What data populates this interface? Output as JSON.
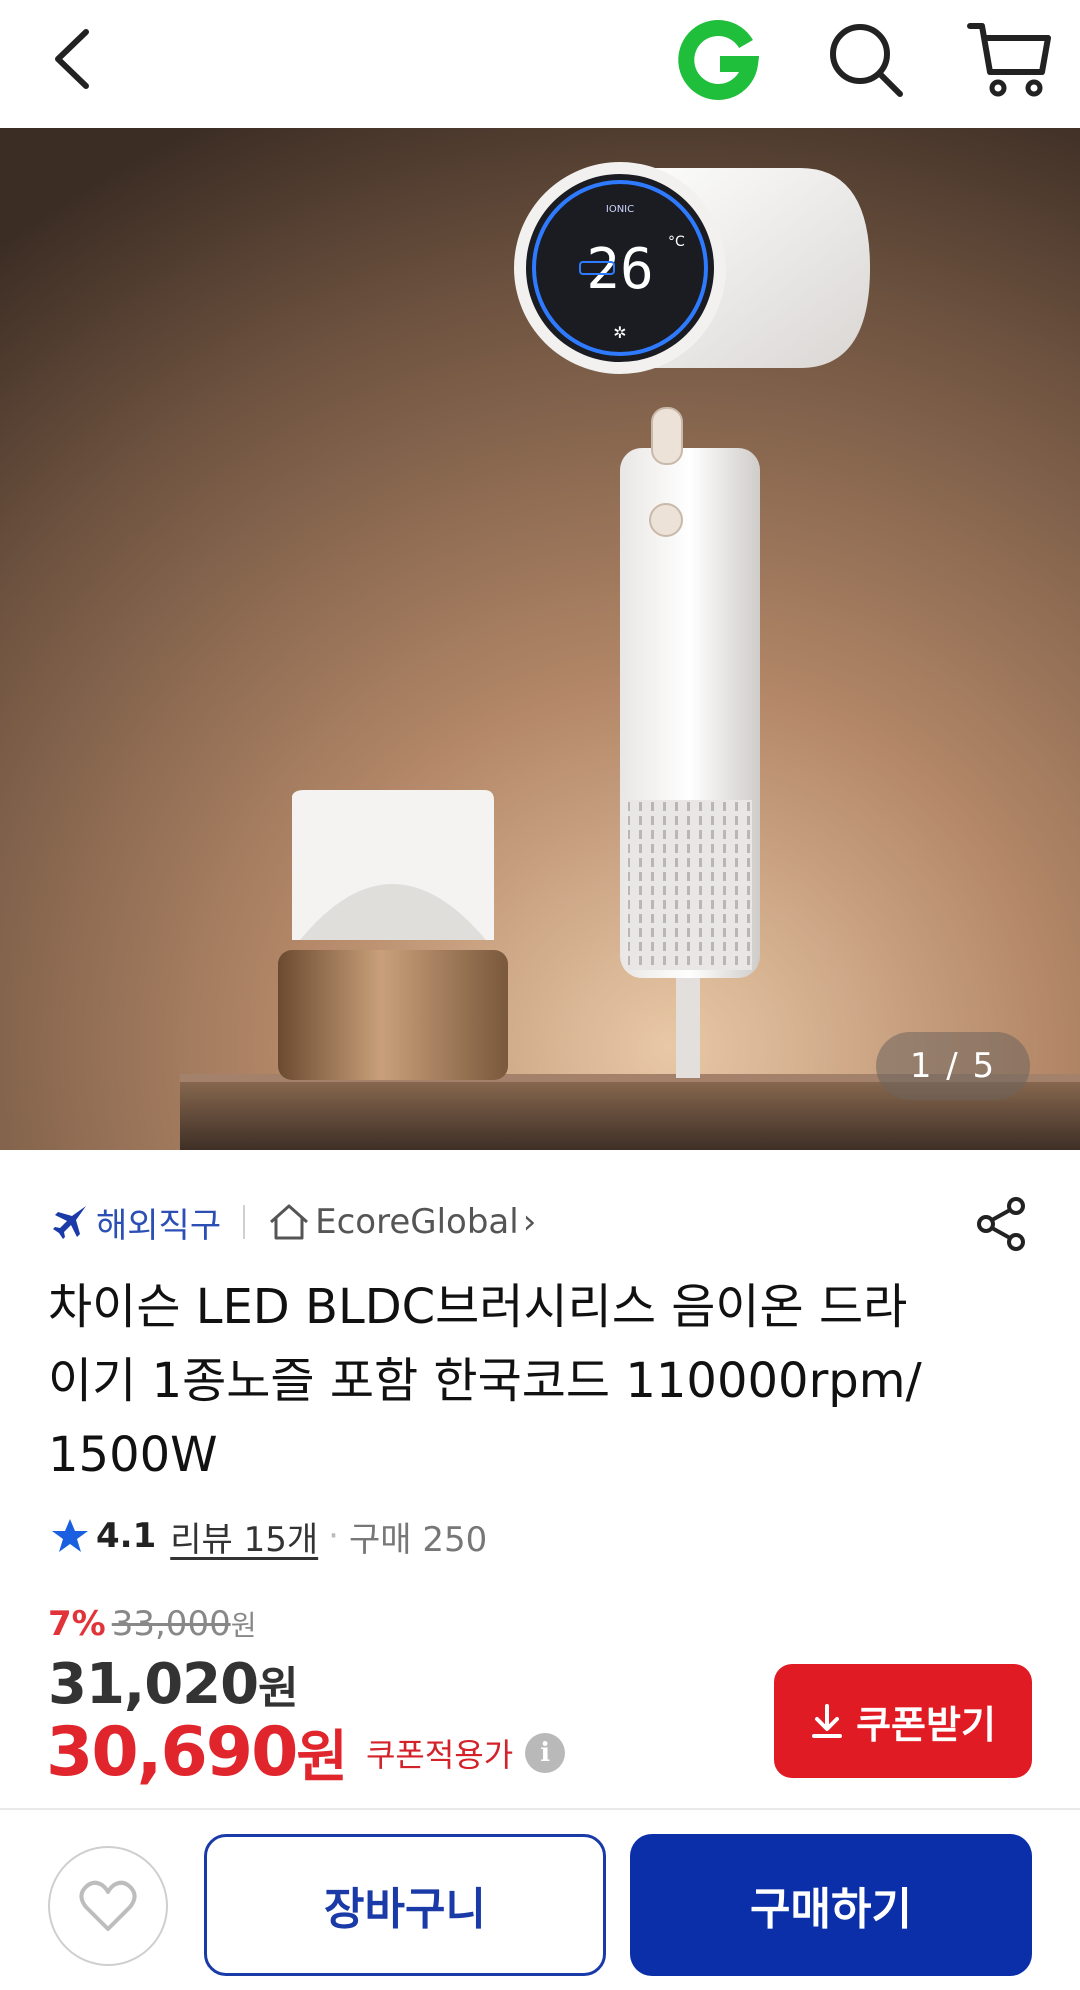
{
  "header": {
    "back_icon": "chevron-left-icon",
    "logo_icon": "gmarket-g-logo",
    "search_icon": "search-icon",
    "cart_icon": "cart-icon"
  },
  "gallery": {
    "counter": "1 / 5"
  },
  "seller": {
    "overseas_label": "해외직구",
    "store_name": "EcoreGlobal",
    "store_chevron": "›"
  },
  "product": {
    "title": "차이슨 LED BLDC브러시리스 음이온 드라이기 1종노즐 포함 한국코드 110000rpm/1500W"
  },
  "rating": {
    "score": "4.1",
    "reviews": "리뷰 15개",
    "purchases": "구매 250"
  },
  "price": {
    "discount": "7%",
    "original": "33,000",
    "original_unit": "원",
    "sale": "31,020",
    "sale_unit": "원",
    "coupon_price": "30,690",
    "coupon_unit": "원",
    "coupon_label": "쿠폰적용가",
    "info_glyph": "i"
  },
  "coupon_button": {
    "label": "쿠폰받기"
  },
  "bottom": {
    "cart_label": "장바구니",
    "buy_label": "구매하기"
  },
  "colors": {
    "accent_red": "#e01b24",
    "primary_blue": "#0a2fa8",
    "overseas_blue": "#2b4fb5",
    "logo_green": "#1fbe3b"
  }
}
